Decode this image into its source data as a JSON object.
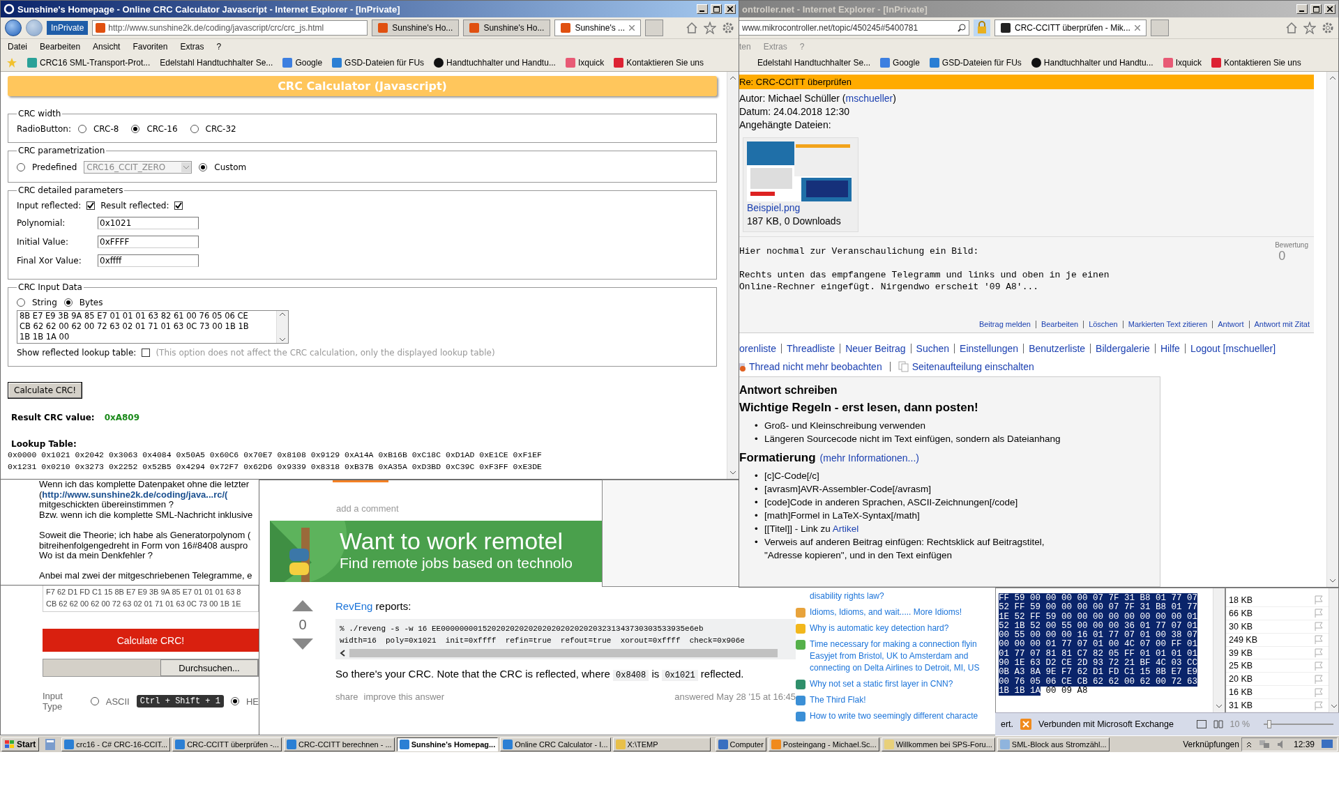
{
  "sunshine_window": {
    "title": "Sunshine's Homepage - Online CRC Calculator Javascript - Internet Explorer - [InPrivate]",
    "inprivate": "InPrivate",
    "url": "http://www.sunshine2k.de/coding/javascript/crc/crc_js.html",
    "tabs": [
      {
        "label": "Sunshine's Ho...",
        "selected": false
      },
      {
        "label": "Sunshine's Ho...",
        "selected": false
      },
      {
        "label": "Sunshine's ...",
        "selected": true
      }
    ],
    "menu": [
      "Datei",
      "Bearbeiten",
      "Ansicht",
      "Favoriten",
      "Extras",
      "?"
    ],
    "favorites": [
      {
        "label": "CRC16 SML-Transport-Prot...",
        "kind": "nk"
      },
      {
        "label": "Edelstahl Handtuchhalter Se...",
        "kind": "none"
      },
      {
        "label": "Google",
        "kind": "google"
      },
      {
        "label": "GSD-Dateien für FUs",
        "kind": "ie"
      },
      {
        "label": "Handtuchhalter und Handtu...",
        "kind": "diamond"
      },
      {
        "label": "Ixquick",
        "kind": "sp"
      },
      {
        "label": "Kontaktieren Sie uns",
        "kind": "contact"
      }
    ],
    "header": "CRC Calculator (Javascript)",
    "crc_width": {
      "legend": "CRC width",
      "label": "RadioButton:",
      "options": [
        {
          "label": "CRC-8",
          "selected": false
        },
        {
          "label": "CRC-16",
          "selected": true
        },
        {
          "label": "CRC-32",
          "selected": false
        }
      ]
    },
    "parametrization": {
      "legend": "CRC parametrization",
      "options": [
        {
          "label": "Predefined",
          "selected": false
        },
        {
          "label": "Custom",
          "selected": true
        }
      ],
      "preset": "CRC16_CCIT_ZERO"
    },
    "detailed": {
      "legend": "CRC detailed parameters",
      "checks": [
        {
          "label": "Input reflected:",
          "checked": true
        },
        {
          "label": "Result reflected:",
          "checked": true
        }
      ],
      "fields": [
        {
          "label": "Polynomial:",
          "value": "0x1021"
        },
        {
          "label": "Initial Value:",
          "value": "0xFFFF"
        },
        {
          "label": "Final Xor Value:",
          "value": "0xffff"
        }
      ]
    },
    "input_data": {
      "legend": "CRC Input Data",
      "options": [
        {
          "label": "String",
          "selected": false
        },
        {
          "label": "Bytes",
          "selected": true
        }
      ],
      "lines": [
        "8B E7 E9 3B 9A 85 E7 01 01 01 63 82 61 00 76 05 06 CE",
        "CB 62 62 00 62 00 72 63 02 01 71 01 63 0C 73 00 1B 1B",
        "1B 1B 1A 00"
      ],
      "reflected_table": {
        "label": "Show reflected lookup table:",
        "checked": false,
        "note": "(This option does not affect the CRC calculation, only the displayed lookup table)"
      }
    },
    "button": "Calculate CRC!",
    "result_label": "Result CRC value:",
    "result_value": "0xA809",
    "lookup_label": "Lookup Table:",
    "lookup_rows": [
      "0x0000 0x1021 0x2042 0x3063 0x4084 0x50A5 0x60C6 0x70E7 0x8108 0x9129 0xA14A 0xB16B 0xC18C 0xD1AD 0xE1CE 0xF1EF",
      "0x1231 0x0210 0x3273 0x2252 0x52B5 0x4294 0x72F7 0x62D6 0x9339 0x8318 0xB37B 0xA35A 0xD3BD 0xC39C 0xF3FF 0xE3DE"
    ]
  },
  "forum_window": {
    "title": "ontroller.net - Internet Explorer - [InPrivate]",
    "url": "www.mikrocontroller.net/topic/450245#5400781",
    "tabs": [
      {
        "label": "CRC-CCITT überprüfen - Mik...",
        "selected": true
      }
    ],
    "menu": [
      "ten",
      "Extras",
      "?"
    ],
    "favorites": [
      {
        "label": "Edelstahl Handtuchhalter Se...",
        "kind": "none"
      },
      {
        "label": "Google",
        "kind": "google"
      },
      {
        "label": "GSD-Dateien für FUs",
        "kind": "ie"
      },
      {
        "label": "Handtuchhalter und Handtu...",
        "kind": "diamond"
      },
      {
        "label": "Ixquick",
        "kind": "sp"
      },
      {
        "label": "Kontaktieren Sie uns",
        "kind": "contact"
      }
    ],
    "post_title": "Re: CRC-CCITT überprüfen",
    "author": "Autor: Michael Schüller (",
    "author_user": "mschueller",
    "author_end": ")",
    "date": "Datum: 24.04.2018 12:30",
    "attachments_label": "Angehängte Dateien:",
    "attachment": {
      "name": "Beispiel.png",
      "info": "187 KB, 0 Downloads"
    },
    "body": [
      {
        "lines": [
          "Hier nochmal zur Veranschaulichung ein Bild:"
        ]
      },
      {
        "lines": [
          "Rechts unten das empfangene Telegramm und links und oben in je einen",
          "Online-Rechner eingefügt. Nirgendwo erscheit '09 A8'..."
        ]
      }
    ],
    "rating_label": "Bewertung",
    "rating": "0",
    "actions": [
      "Beitrag melden",
      "Bearbeiten",
      "Löschen",
      "Markierten Text zitieren",
      "Antwort",
      "Antwort mit Zitat"
    ],
    "nav": [
      "orenliste",
      "Threadliste",
      "Neuer Beitrag",
      "Suchen",
      "Einstellungen",
      "Benutzerliste",
      "Bildergalerie",
      "Hilfe",
      "Logout [mschueller]"
    ],
    "watch": [
      "Thread nicht mehr beobachten",
      "Seitenaufteilung einschalten"
    ],
    "reply": {
      "title": "Antwort schreiben",
      "rules_title": "Wichtige Regeln - erst lesen, dann posten!",
      "rules": [
        {
          "marker": "•",
          "text": "Groß- und Kleinschreibung verwenden"
        },
        {
          "marker": "•",
          "text": "Längeren Sourcecode nicht im Text einfügen, sondern als Dateianhang"
        }
      ],
      "format_title": "Formatierung",
      "format_more": "(mehr Informationen...)",
      "format_items": [
        {
          "marker": "•",
          "text": "[c]C-Code[/c]"
        },
        {
          "marker": "•",
          "text": "[avrasm]AVR-Assembler-Code[/avrasm]"
        },
        {
          "marker": "•",
          "text": "[code]Code in anderen Sprachen, ASCII-Zeichnungen[/code]"
        },
        {
          "marker": "•",
          "text": "[math]Formel in LaTeX-Syntax[/math]"
        },
        {
          "marker": "•",
          "text": "[[Titel]] - Link zu ",
          "link": "Artikel"
        },
        {
          "marker": "•",
          "text": "Verweis auf anderen Beitrag einfügen: Rechtsklick auf Beitragstitel,"
        }
      ],
      "cut_line": "\"Adresse kopieren\", und in den Text einfügen"
    }
  },
  "question_window": {
    "paragraphs": [
      {
        "lines": [
          {
            "text": "Wenn ich das komplette Datenpaket ohne die letzter"
          },
          {
            "text": "(",
            "link": "http://www.sunshine2k.de/coding/java...rc/("
          },
          {
            "text": "mitgeschickten übereinstimmen ?"
          },
          {
            "text": "Bzw. wenn ich die komplette SML-Nachricht inklusive"
          }
        ]
      },
      {
        "lines": [
          {
            "text": "Soweit die Theorie; ich habe als Generatorpolynom ("
          },
          {
            "text": "bitreihenfolgengedreht in Form von 16#8408 auspro"
          },
          {
            "text": "Wo ist da mein Denkfehler ?"
          }
        ]
      },
      {
        "lines": [
          {
            "text": "Anbei mal zwei der mitgeschriebenen Telegramme, e"
          }
        ]
      }
    ]
  },
  "calc_window": {
    "lines": [
      "F7 62 D1 FD C1 15 8B E7 E9 3B 9A 85 E7 01 01 01 63 8",
      "CB 62 62 00 62 00 72 63 02 01 71 01 63 0C 73 00 1B 1E"
    ],
    "button": "Calculate CRC!",
    "browse": "Durchsuchen...",
    "input_type": "Input Type",
    "options": [
      {
        "label": "ASCII",
        "selected": false
      },
      {
        "label": "HE",
        "selected": true
      }
    ],
    "shortcut": "Ctrl + Shift + 1"
  },
  "answer_window": {
    "add_comment": "add a comment",
    "banner_title": "Want to work remotel",
    "banner_sub": "Find remote jobs based on technolo",
    "votes": "0",
    "user": "RevEng",
    "reports": " reports:",
    "code": [
      "% ./reveng -s -w 16 EE00000000152020202020202020202020203231343730303533935e6eb",
      "width=16  poly=0x1021  init=0xffff  refin=true  refout=true  xorout=0xffff  check=0x906e"
    ],
    "note": [
      {
        "text": "So there's your CRC. Note that the CRC is reflected, where "
      },
      {
        "code": "0x8408"
      },
      {
        "text": " is "
      },
      {
        "code": "0x1021"
      },
      {
        "text": " reflected."
      }
    ],
    "share": "share",
    "improve": "improve this answer",
    "answered": "answered May 28 '15 at 16:45",
    "sidebar": [
      {
        "label": "disability rights law?"
      },
      {
        "label": "Idioms, Idioms, and wait..... More Idioms!",
        "color": "#e8a33b"
      },
      {
        "label": "Why is automatic key detection hard?",
        "color": "#f2b71c"
      },
      {
        "label": "Time necessary for making a connection flyin Easyjet from Bristol, UK to Amsterdam and connecting on Delta Airlines to Detroit, MI, US",
        "color": "#55b04a"
      },
      {
        "label": "Why not set a static first layer in CNN?",
        "color": "#2f8f6b"
      },
      {
        "label": "The Third Flak!",
        "color": "#3b8fd6"
      },
      {
        "label": "How to write two seemingly different characte",
        "color": "#3b8fd6"
      }
    ]
  },
  "hex_window": {
    "lines": [
      {
        "selected": "FF 59 00 00 00 00 07 7F 31 B8 01 77 07"
      },
      {
        "selected": "52 FF 59 00 00 00 00 07 7F 31 B8 01 77"
      },
      {
        "selected": "1E 52 FF 59 00 00 00 00 00 00 00 00 01"
      },
      {
        "selected": "52 1B 52 00 55 00 00 00 36 01 77 07 01"
      },
      {
        "selected": "00 55 00 00 00 16 01 77 07 01 00 38 07"
      },
      {
        "selected": "00 00 00 01 77 07 01 00 4C 07 00 FF 01"
      },
      {
        "selected": "01 77 07 81 81 C7 82 05 FF 01 01 01 01"
      },
      {
        "selected": "90 1E 63 D2 CE 2D 93 72 21 BF 4C 03 CC"
      },
      {
        "selected": "0B A3 8A 9E F7 62 D1 FD C1 15 8B E7 E9"
      },
      {
        "selected": "00 76 05 06 CE CB 62 62 00 62 00 72 63"
      },
      {
        "selected": "1B 1B 1A",
        "rest": "00 09 A8"
      }
    ]
  },
  "mail_window": {
    "sizes": [
      "18 KB",
      "66 KB",
      "30 KB",
      "249 KB",
      "39 KB",
      "25 KB",
      "20 KB",
      "16 KB",
      "31 KB"
    ],
    "status": {
      "left": "ert.",
      "connection": "Verbunden mit Microsoft Exchange",
      "zoom": "10 %",
      "level": 0.05
    }
  },
  "taskbar": {
    "start": "Start",
    "items": [
      {
        "label": "crc16 - C# CRC-16-CCIT...",
        "kind": "ie",
        "selected": false
      },
      {
        "label": "CRC-CCITT überprüfen -...",
        "kind": "ie",
        "selected": false
      },
      {
        "label": "CRC-CCITT berechnen - ...",
        "kind": "ie",
        "selected": false
      },
      {
        "label": "Sunshine's Homepag...",
        "kind": "ie",
        "selected": true
      },
      {
        "label": "Online CRC Calculator - I...",
        "kind": "ie",
        "selected": false
      },
      {
        "label": "X:\\TEMP",
        "kind": "folder",
        "selected": false
      },
      {
        "label": "Computer",
        "kind": "computer",
        "selected": false
      },
      {
        "label": "Posteingang - Michael.Sc...",
        "kind": "outlook",
        "selected": false
      },
      {
        "label": "Willkommen bei SPS-Foru...",
        "kind": "mail",
        "selected": false
      },
      {
        "label": "SML-Block aus Stromzähl...",
        "kind": "notepad",
        "selected": false
      }
    ],
    "links": "Verknüpfungen",
    "clock": "12:39"
  }
}
